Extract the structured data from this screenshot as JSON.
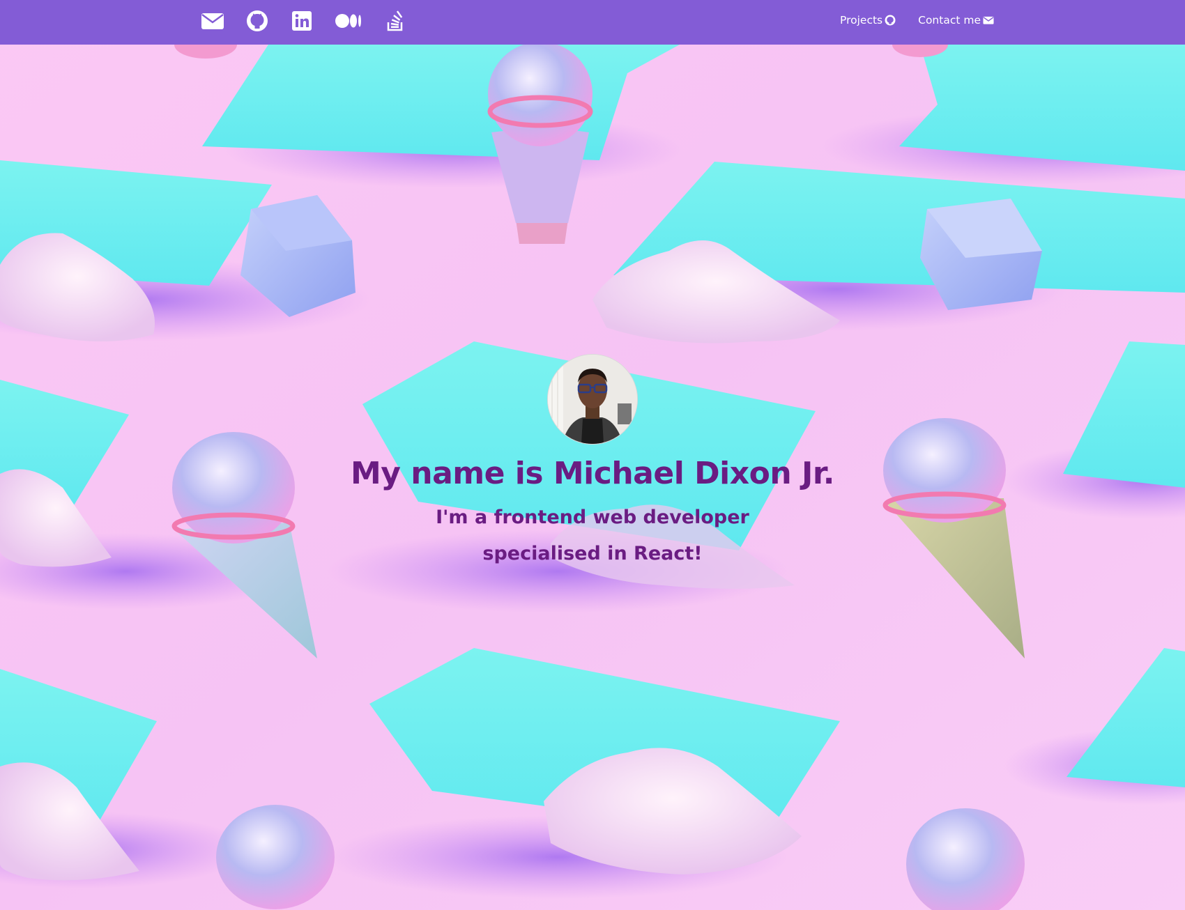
{
  "navbar": {
    "background": "#835cd6",
    "social_icons": [
      {
        "name": "envelope-icon"
      },
      {
        "name": "github-icon"
      },
      {
        "name": "linkedin-icon"
      },
      {
        "name": "medium-icon"
      },
      {
        "name": "stackoverflow-icon"
      }
    ],
    "links": [
      {
        "label": "Projects",
        "icon": "github-icon"
      },
      {
        "label": "Contact me",
        "icon": "envelope-icon"
      }
    ]
  },
  "hero": {
    "avatar": "profile-photo",
    "title": "My name is Michael Dixon Jr.",
    "subtitle_line1": "I'm a frontend web developer",
    "subtitle_line2": "specialised in React!",
    "text_color": "#6a1c82"
  }
}
